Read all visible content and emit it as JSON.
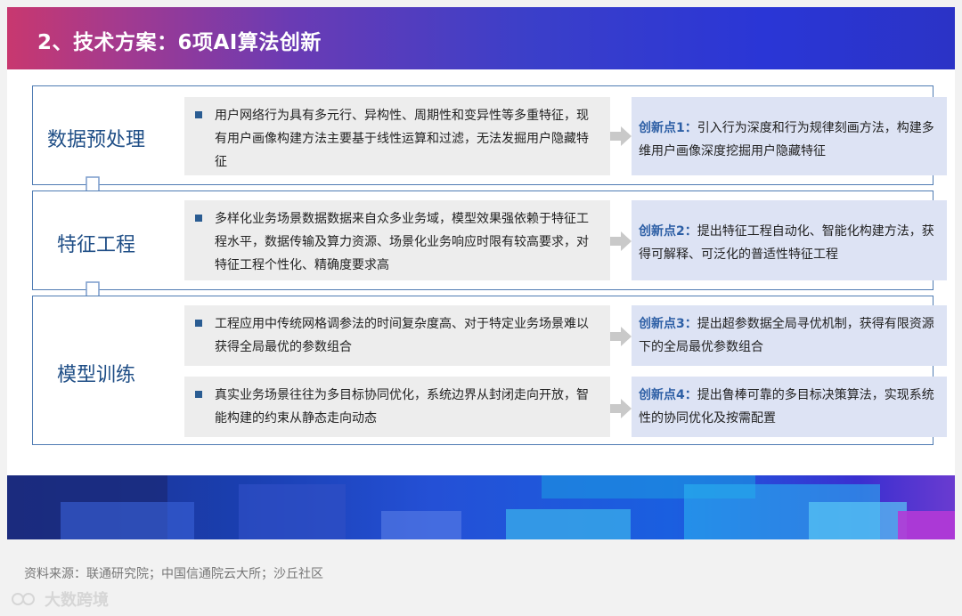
{
  "title": "2、技术方案：6项AI算法创新",
  "stages": [
    {
      "label": "数据预处理",
      "rows": [
        {
          "problem": "用户网络行为具有多元行、异构性、周期性和变异性等多重特征，现有用户画像构建方法主要基于线性运算和过滤，无法发掘用户隐藏特征",
          "tag": "创新点1：",
          "innovation": "引入行为深度和行为规律刻画方法，构建多维用户画像深度挖掘用户隐藏特征"
        }
      ]
    },
    {
      "label": "特征工程",
      "rows": [
        {
          "problem": "多样化业务场景数据数据来自众多业务域，模型效果强依赖于特征工程水平，数据传输及算力资源、场景化业务响应时限有较高要求，对特征工程个性化、精确度要求高",
          "tag": "创新点2：",
          "innovation": "提出特征工程自动化、智能化构建方法，获得可解释、可泛化的普适性特征工程"
        }
      ]
    },
    {
      "label": "模型训练",
      "rows": [
        {
          "problem": "工程应用中传统网格调参法的时间复杂度高、对于特定业务场景难以获得全局最优的参数组合",
          "tag": "创新点3：",
          "innovation": "提出超参数据全局寻优机制，获得有限资源下的全局最优参数组合"
        },
        {
          "problem": "真实业务场景往往为多目标协同优化，系统边界从封闭走向开放，智能构建的约束从静态走向动态",
          "tag": "创新点4：",
          "innovation": "提出鲁棒可靠的多目标决策算法，实现系统性的协同优化及按需配置"
        }
      ]
    }
  ],
  "source": "资料来源：联通研究院；中国信通院云大所；沙丘社区",
  "watermark": "大数跨境",
  "colors": {
    "stage_border": "#4f7bb3",
    "stage_label": "#1f4e86",
    "problem_bg": "#ededed",
    "innovation_bg": "#dde3f4",
    "tag": "#2d5fa5",
    "arrow": "#c9c9c9"
  },
  "icons": {
    "bullet": "square-bullet-icon",
    "right_arrow": "right-arrow-icon",
    "down_arrow": "down-arrow-icon"
  }
}
